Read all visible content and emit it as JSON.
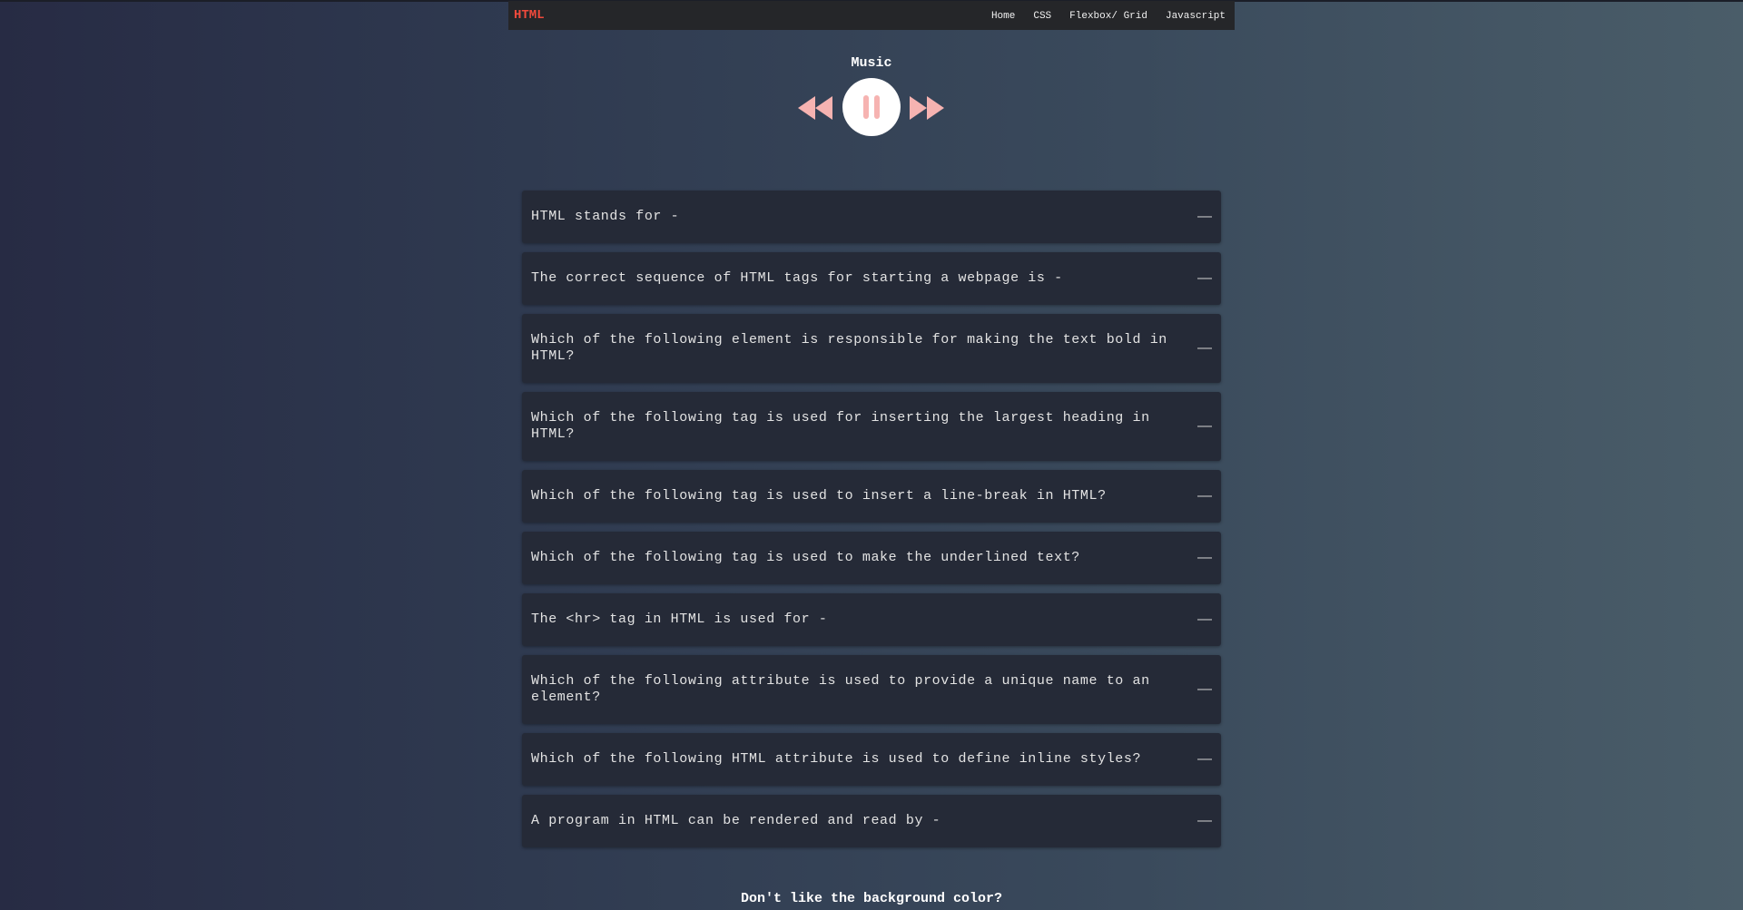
{
  "navbar": {
    "brand": "HTML",
    "links": [
      "Home",
      "CSS",
      "Flexbox/ Grid",
      "Javascript"
    ]
  },
  "music": {
    "title": "Music",
    "controls": {
      "prev_icon": "rewind-icon",
      "play_icon": "pause-icon",
      "next_icon": "fast-forward-icon"
    }
  },
  "faq": {
    "items": [
      {
        "question": "HTML stands for -",
        "toggle": "—"
      },
      {
        "question": "The correct sequence of HTML tags for starting a webpage is -",
        "toggle": "—"
      },
      {
        "question": "Which of the following element is responsible for making the text bold in HTML?",
        "toggle": "—"
      },
      {
        "question": "Which of the following tag is used for inserting the largest heading in HTML?",
        "toggle": "—"
      },
      {
        "question": "Which of the following tag is used to insert a line-break in HTML?",
        "toggle": "—"
      },
      {
        "question": "Which of the following tag is used to make the underlined text?",
        "toggle": "—"
      },
      {
        "question": "The <hr> tag in HTML is used for -",
        "toggle": "—"
      },
      {
        "question": "Which of the following attribute is used to provide a unique name to an element?",
        "toggle": "—"
      },
      {
        "question": "Which of the following HTML attribute is used to define inline styles?",
        "toggle": "—"
      },
      {
        "question": "A program in HTML can be rendered and read by -",
        "toggle": "—"
      }
    ]
  },
  "footer": {
    "prompt": "Don't like the background color?"
  },
  "colors": {
    "brand": "#f04a3c",
    "player_icon": "#f6b3b1",
    "card": "#252a37"
  }
}
